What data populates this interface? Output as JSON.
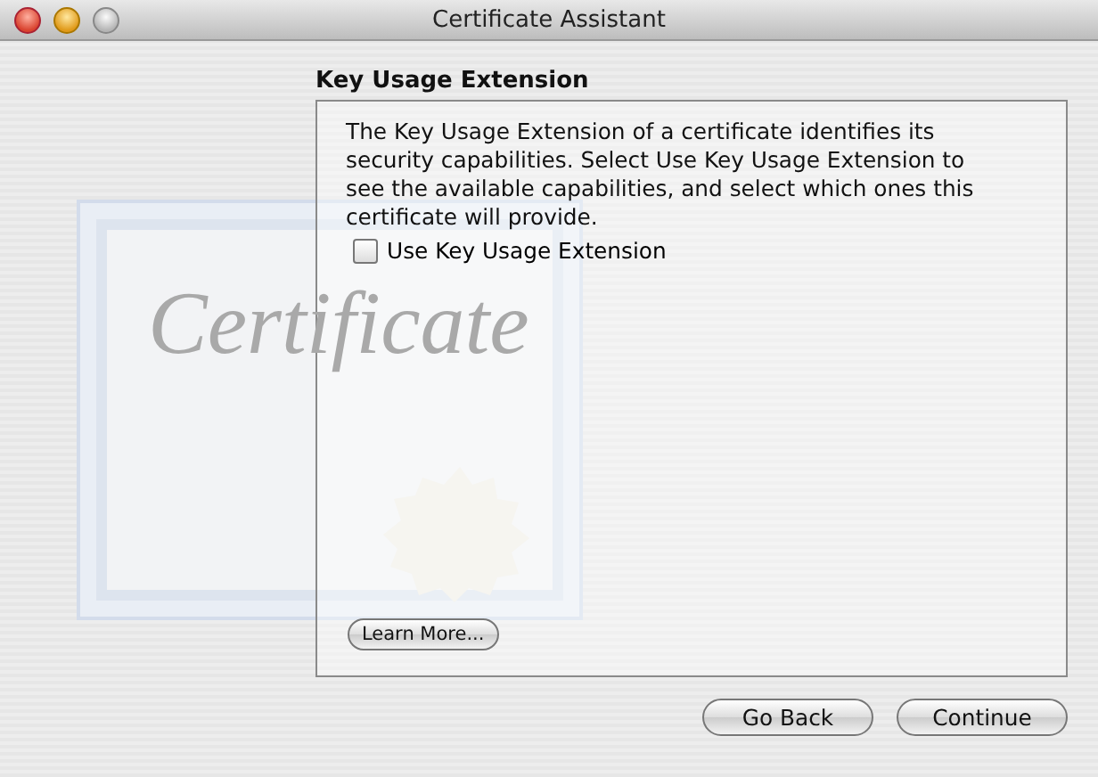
{
  "window": {
    "title": "Certificate Assistant"
  },
  "background_art": {
    "text": "Certificate"
  },
  "heading": "Key Usage Extension",
  "description": "The Key Usage Extension of a certificate identifies its security capabilities. Select Use Key Usage Extension to see the available capabilities, and select which ones this certificate will provide.",
  "checkbox": {
    "label": "Use Key Usage Extension",
    "checked": false
  },
  "learn_more": "Learn More...",
  "buttons": [
    "Go Back",
    "Continue"
  ]
}
